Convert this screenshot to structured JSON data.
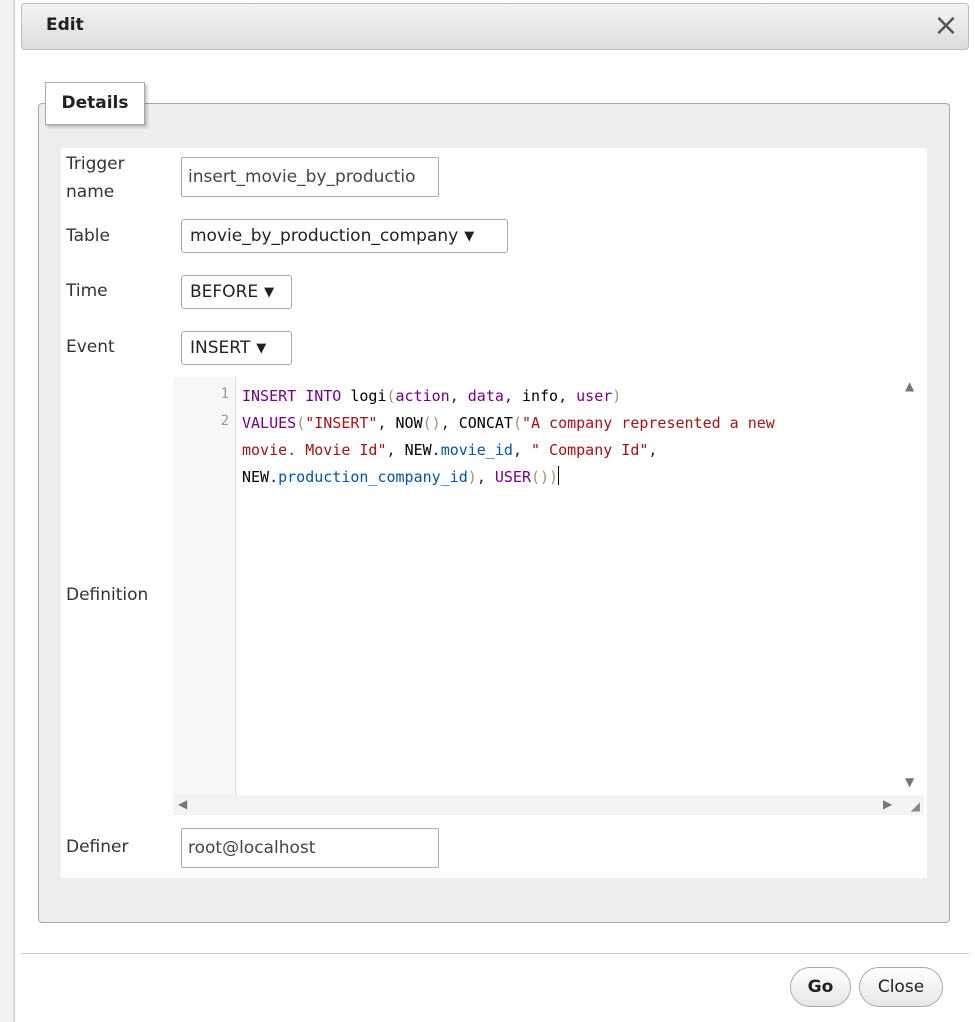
{
  "dialog": {
    "title": "Edit",
    "close_icon": "×"
  },
  "tab": {
    "label": "Details"
  },
  "form": {
    "trigger_name_label_1": "Trigger",
    "trigger_name_label_2": "name",
    "trigger_name_value": "insert_movie_by_productio",
    "table_label": "Table",
    "table_value": "movie_by_production_company",
    "time_label": "Time",
    "time_value": "BEFORE",
    "event_label": "Event",
    "event_value": "INSERT",
    "definition_label": "Definition",
    "definer_label": "Definer",
    "definer_value": "root@localhost"
  },
  "editor": {
    "line_numbers": [
      "1",
      "2"
    ],
    "tokens": {
      "insert_into": "INSERT INTO",
      "logi": "logi",
      "action": "action",
      "data": "data",
      "info": "info",
      "user": "user",
      "values": "VALUES",
      "str_insert": "\"INSERT\"",
      "now": "NOW",
      "concat": "CONCAT",
      "str_company_1": "\"A company represented a new",
      "str_company_2": "movie. Movie Id\"",
      "new_1": "NEW",
      "movie_id": "movie_id",
      "str_company_id": "\" Company Id\"",
      "new_2": "NEW",
      "production_company_id": "production_company_id",
      "user_fn": "USER"
    }
  },
  "buttons": {
    "go": "Go",
    "close": "Close"
  },
  "icons": {
    "chevron": "chevron-down-icon",
    "scroll_up": "▲",
    "scroll_down": "▼",
    "scroll_left": "◀",
    "scroll_right": "▶",
    "resize": "◢"
  }
}
